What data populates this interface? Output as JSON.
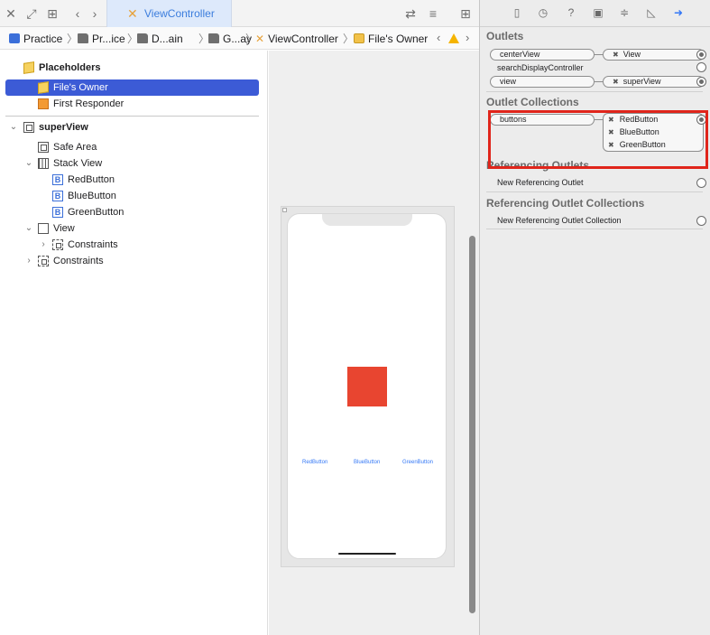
{
  "tabbar": {
    "active_tab_label": "ViewController"
  },
  "breadcrumb": {
    "items": [
      "Practice",
      "Pr...ice",
      "D...ain",
      "G...ay",
      "ViewController",
      "File's Owner"
    ]
  },
  "outline": {
    "placeholders_label": "Placeholders",
    "files_owner": "File's Owner",
    "first_responder": "First Responder",
    "super_view": "superView",
    "safe_area": "Safe Area",
    "stack_view": "Stack View",
    "red_button": "RedButton",
    "blue_button": "BlueButton",
    "green_button": "GreenButton",
    "view": "View",
    "constraints_inner": "Constraints",
    "constraints_outer": "Constraints"
  },
  "canvas": {
    "buttons": [
      "RedButton",
      "BlueButton",
      "GreenButton"
    ],
    "accent_color": "#e84530"
  },
  "inspector": {
    "outlets_title": "Outlets",
    "outlets": [
      {
        "name": "centerView",
        "target": "View"
      },
      {
        "name": "searchDisplayController",
        "target": ""
      },
      {
        "name": "view",
        "target": "superView"
      }
    ],
    "outlet_collections_title": "Outlet Collections",
    "collection_name": "buttons",
    "collection_targets": [
      "RedButton",
      "BlueButton",
      "GreenButton"
    ],
    "referencing_outlets_title": "Referencing Outlets",
    "new_referencing_outlet": "New Referencing Outlet",
    "referencing_collections_title": "Referencing Outlet Collections",
    "new_referencing_collection": "New Referencing Outlet Collection",
    "highlight_color": "#e0251b"
  }
}
